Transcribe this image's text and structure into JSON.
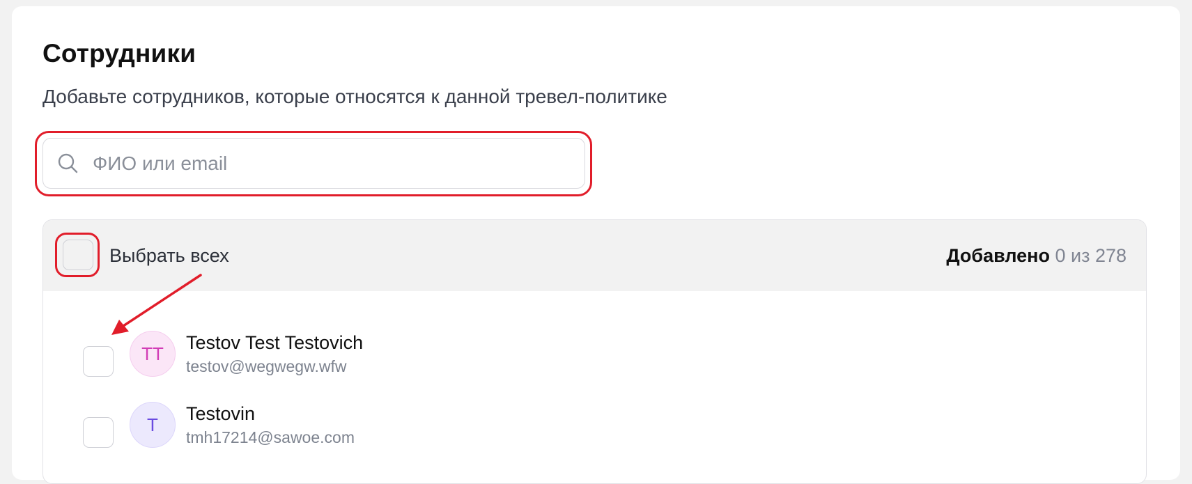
{
  "section": {
    "title": "Сотрудники",
    "subtitle": "Добавьте сотрудников, которые относятся к данной тревел-политике"
  },
  "search": {
    "placeholder": "ФИО или email",
    "value": "",
    "icon": "search-icon"
  },
  "list": {
    "select_all_label": "Выбрать всех",
    "added_label": "Добавлено",
    "added_count": "0 из 278",
    "employees": [
      {
        "initials": "TT",
        "name": "Testov Test Testovich",
        "email": "testov@wegwegw.wfw",
        "avatar_color": "#d23cb6",
        "checked": false
      },
      {
        "initials": "T",
        "name": "Testovin",
        "email": "tmh17214@sawoe.com",
        "avatar_color": "#6a4be0",
        "checked": false
      }
    ]
  },
  "annotation": {
    "highlight_color": "#e11d2a"
  }
}
